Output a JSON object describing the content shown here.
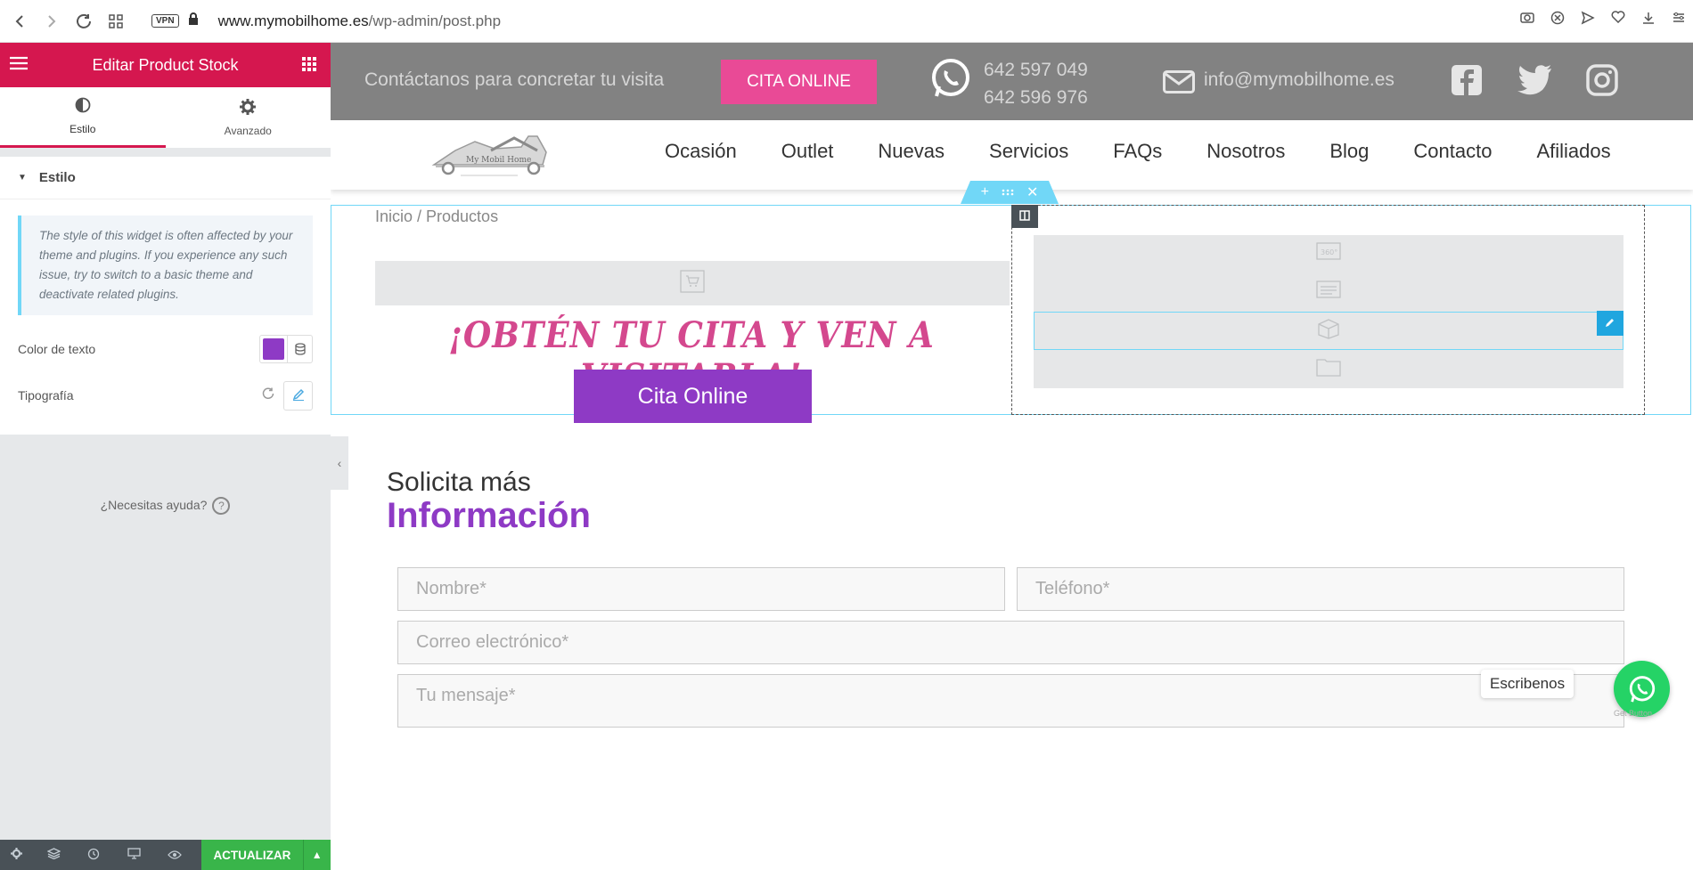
{
  "browser": {
    "vpn_label": "VPN",
    "url_host": "www.mymobilhome.es",
    "url_path": "/wp-admin/post.php"
  },
  "panel": {
    "title": "Editar Product Stock",
    "tabs": [
      {
        "label": "Estilo",
        "icon": "half-circle-icon"
      },
      {
        "label": "Avanzado",
        "icon": "gear-icon"
      }
    ],
    "section_title": "Estilo",
    "notice": "The style of this widget is often affected by your theme and plugins. If you experience any such issue, try to switch to a basic theme and deactivate related plugins.",
    "color_label": "Color de texto",
    "color_value": "#8e3ac5",
    "typography_label": "Tipografía",
    "help_text": "¿Necesitas ayuda?",
    "help_icon": "?",
    "update_label": "ACTUALIZAR"
  },
  "site": {
    "topbar": {
      "contact_text": "Contáctanos para concretar tu visita",
      "cita_label": "CITA ONLINE",
      "phone1": "642 597 049",
      "phone2": "642 596 976",
      "email": "info@mymobilhome.es"
    },
    "logo_text": "My Mobil Home",
    "nav": [
      "Ocasión",
      "Outlet",
      "Nuevas",
      "Servicios",
      "FAQs",
      "Nosotros",
      "Blog",
      "Contacto",
      "Afiliados"
    ],
    "breadcrumb": "Inicio / Productos",
    "headline": "¡OBTÉN TU CITA Y VEN A VISITARLA!",
    "cita_button": "Cita Online",
    "solicita": "Solicita más",
    "informacion": "Información",
    "form": {
      "nombre": "Nombre*",
      "telefono": "Teléfono*",
      "correo": "Correo electrónico*",
      "mensaje": "Tu mensaje*"
    },
    "whatsapp_label": "Escribenos",
    "chat_credit": "Get Button"
  },
  "colors": {
    "elementor_pink": "#d5174f",
    "accent_purple": "#8e3ac5",
    "cita_pink": "#e94a96",
    "update_green": "#39b54a",
    "selection_blue": "#71d7f7"
  }
}
